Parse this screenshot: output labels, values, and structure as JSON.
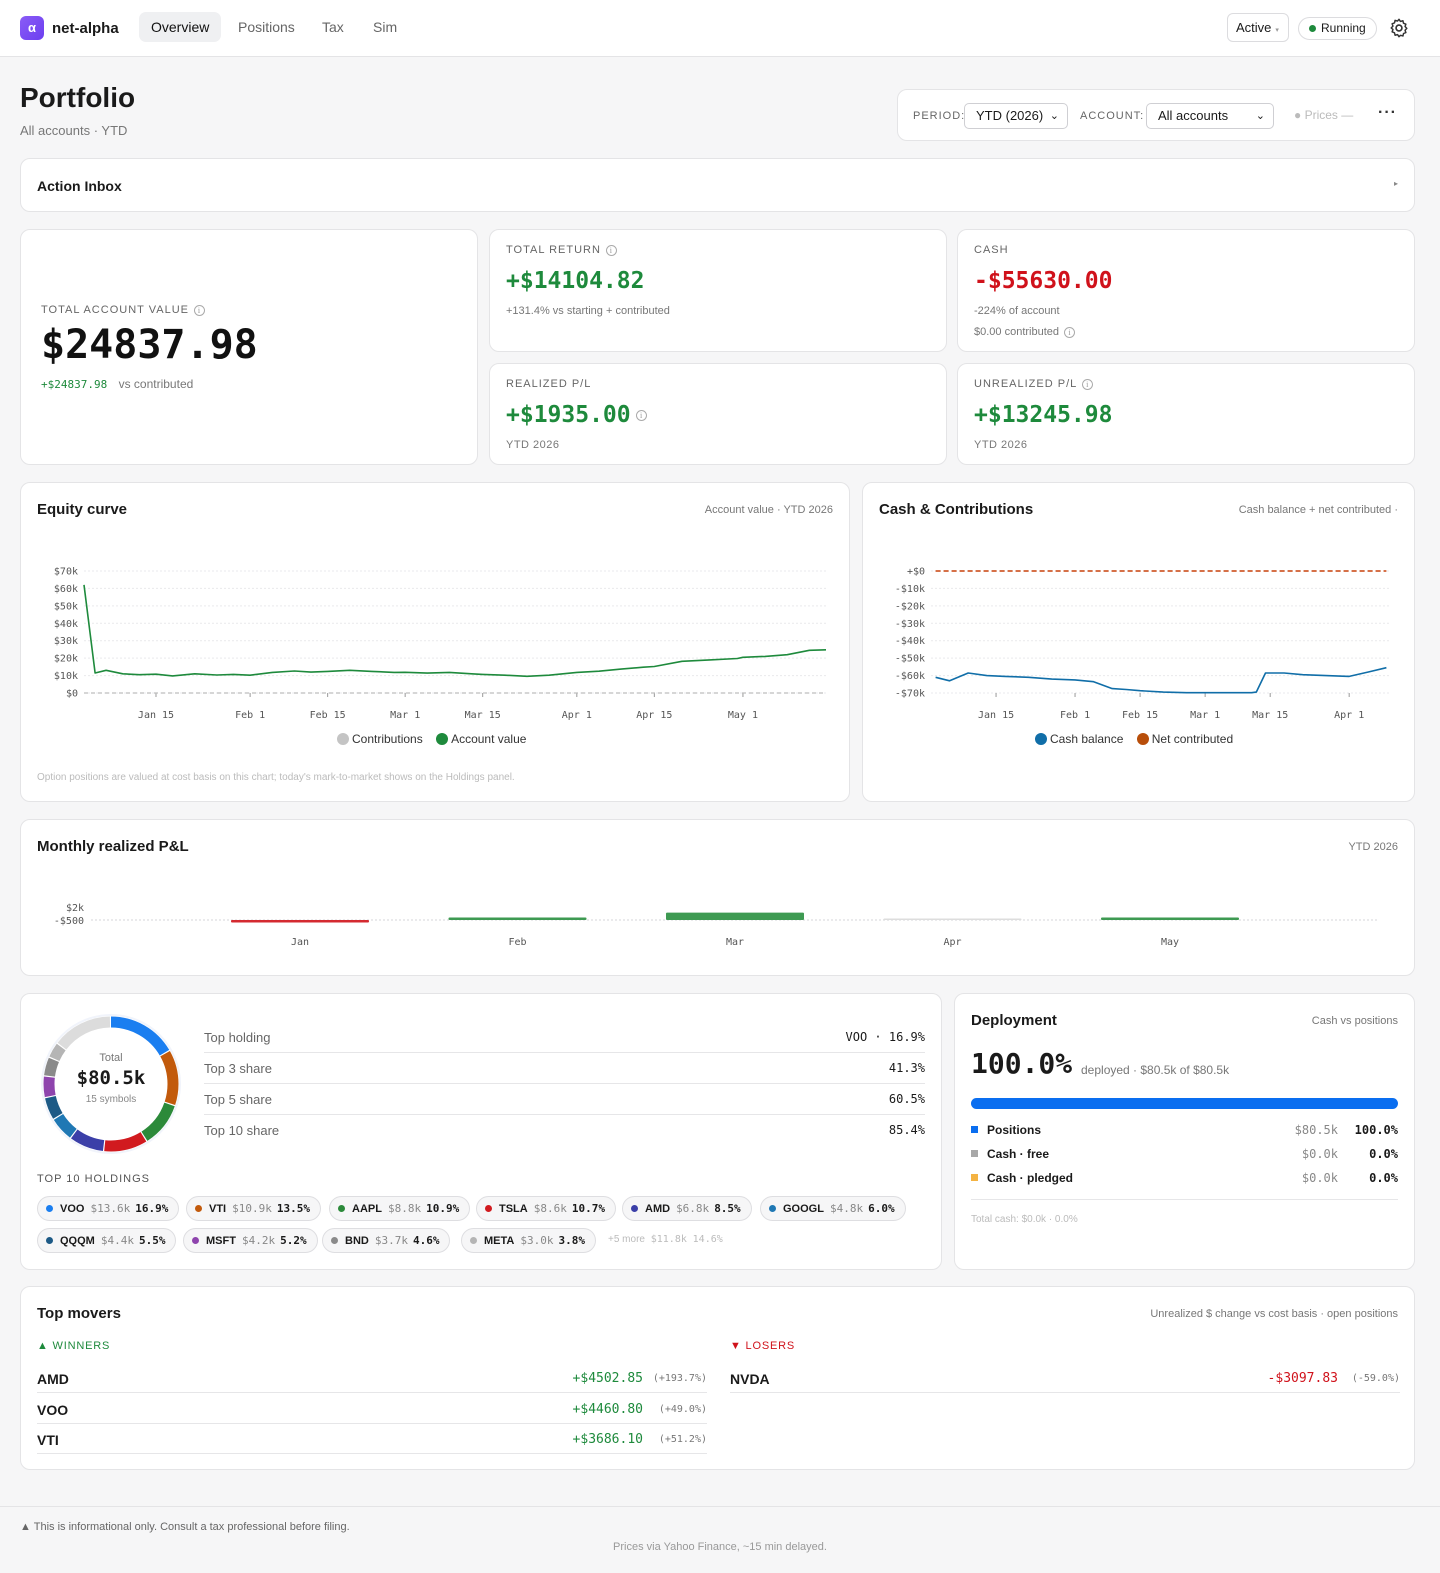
{
  "app": {
    "name": "net-alpha",
    "logo_glyph": "α"
  },
  "nav": {
    "tabs": [
      "Overview",
      "Positions",
      "Tax",
      "Sim"
    ],
    "active": "Overview"
  },
  "topbar": {
    "profile_select": "Active",
    "status": "Running"
  },
  "header": {
    "title": "Portfolio",
    "subtitle": "All accounts · YTD"
  },
  "filters": {
    "period_label": "PERIOD:",
    "period_value": "YTD (2026)",
    "account_label": "ACCOUNT:",
    "account_value": "All accounts",
    "prices": "Prices —",
    "more": "···"
  },
  "action_inbox": {
    "title": "Action Inbox",
    "caret": "▸"
  },
  "stats": {
    "total_account_value": {
      "label": "TOTAL ACCOUNT VALUE",
      "value": "$24837.98",
      "delta": "+$24837.98",
      "delta_note": "vs contributed"
    },
    "total_return": {
      "label": "TOTAL RETURN",
      "value": "+$14104.82",
      "note": "+131.4% vs starting + contributed"
    },
    "cash": {
      "label": "CASH",
      "value": "-$55630.00",
      "note1": "-224% of account",
      "note2": "$0.00 contributed"
    },
    "realized": {
      "label": "REALIZED P/L",
      "value": "+$1935.00",
      "note": "YTD 2026"
    },
    "unrealized": {
      "label": "UNREALIZED P/L",
      "value": "+$13245.98",
      "note": "YTD 2026"
    }
  },
  "equity_curve": {
    "title": "Equity curve",
    "meta": "Account value · YTD 2026",
    "footnote": "Option positions are valued at cost basis on this chart; today's mark-to-market shows on the Holdings panel.",
    "legend": [
      "Contributions",
      "Account value"
    ]
  },
  "cash_chart": {
    "title": "Cash & Contributions",
    "meta": "Cash balance + net contributed ·",
    "legend": [
      "Cash balance",
      "Net contributed"
    ]
  },
  "monthly_pl": {
    "title": "Monthly realized P&L",
    "meta": "YTD 2026"
  },
  "chart_data": [
    {
      "type": "line",
      "x_ticks": [
        "Jan 15",
        "Feb 1",
        "Feb 15",
        "Mar 1",
        "Mar 15",
        "Apr 1",
        "Apr 15",
        "May 1"
      ],
      "y_ticks": [
        "$0",
        "$10k",
        "$20k",
        "$30k",
        "$40k",
        "$50k",
        "$60k",
        "$70k"
      ],
      "ylim": [
        0,
        70000
      ],
      "x": [
        "Jan 2",
        "Jan 4",
        "Jan 6",
        "Jan 9",
        "Jan 12",
        "Jan 15",
        "Jan 18",
        "Jan 22",
        "Jan 26",
        "Jan 29",
        "Feb 1",
        "Feb 5",
        "Feb 9",
        "Feb 12",
        "Feb 15",
        "Feb 19",
        "Feb 23",
        "Feb 27",
        "Mar 1",
        "Mar 5",
        "Mar 9",
        "Mar 13",
        "Mar 15",
        "Mar 19",
        "Mar 23",
        "Mar 27",
        "Apr 1",
        "Apr 5",
        "Apr 9",
        "Apr 13",
        "Apr 15",
        "Apr 20",
        "Apr 25",
        "Apr 30",
        "May 1",
        "May 5",
        "May 9",
        "May 13",
        "May 16"
      ],
      "series": [
        {
          "name": "Account value",
          "values": [
            62000,
            11500,
            13000,
            11000,
            10500,
            10800,
            9800,
            11000,
            10300,
            10700,
            10200,
            11800,
            12600,
            12000,
            12400,
            13000,
            12400,
            11800,
            11900,
            11400,
            11800,
            11000,
            10700,
            10200,
            9600,
            10200,
            11800,
            12500,
            13700,
            14800,
            15200,
            18200,
            19000,
            19800,
            20500,
            21000,
            22000,
            24500,
            24800
          ]
        },
        {
          "name": "Contributions",
          "values": [
            0,
            0,
            0,
            0,
            0,
            0,
            0,
            0,
            0,
            0,
            0,
            0,
            0,
            0,
            0,
            0,
            0,
            0,
            0,
            0,
            0,
            0,
            0,
            0,
            0,
            0,
            0,
            0,
            0,
            0,
            0,
            0,
            0,
            0,
            0,
            0,
            0,
            0,
            0
          ]
        }
      ]
    },
    {
      "type": "line",
      "x_ticks": [
        "Jan 15",
        "Feb 1",
        "Feb 15",
        "Mar 1",
        "Mar 15",
        "Apr 1"
      ],
      "y_ticks": [
        "-$70k",
        "-$60k",
        "-$50k",
        "-$40k",
        "-$30k",
        "-$20k",
        "-$10k",
        "+$0"
      ],
      "ylim": [
        -70000,
        0
      ],
      "x": [
        "Jan 2",
        "Jan 5",
        "Jan 9",
        "Jan 13",
        "Jan 17",
        "Jan 22",
        "Jan 27",
        "Feb 1",
        "Feb 5",
        "Feb 9",
        "Feb 12",
        "Feb 15",
        "Feb 20",
        "Feb 25",
        "Mar 1",
        "Mar 6",
        "Mar 11",
        "Mar 12",
        "Mar 14",
        "Mar 18",
        "Mar 22",
        "Mar 27",
        "Apr 1",
        "Apr 5",
        "Apr 9"
      ],
      "series": [
        {
          "name": "Cash balance",
          "values": [
            -61000,
            -63000,
            -58500,
            -60000,
            -60500,
            -61000,
            -62000,
            -62500,
            -63500,
            -67500,
            -68000,
            -68700,
            -69500,
            -69800,
            -69800,
            -69800,
            -69800,
            -69500,
            -58500,
            -58500,
            -59500,
            -60000,
            -60500,
            -58000,
            -55500
          ]
        },
        {
          "name": "Net contributed",
          "values": [
            0,
            0,
            0,
            0,
            0,
            0,
            0,
            0,
            0,
            0,
            0,
            0,
            0,
            0,
            0,
            0,
            0,
            0,
            0,
            0,
            0,
            0,
            0,
            0,
            0
          ]
        }
      ]
    },
    {
      "type": "bar",
      "categories": [
        "Jan",
        "Feb",
        "Mar",
        "Apr",
        "May"
      ],
      "values": [
        -500,
        100,
        2100,
        0,
        100
      ],
      "y_ticks": [
        "-$500",
        "$2k"
      ],
      "ylim": [
        -500,
        2000
      ]
    }
  ],
  "concentration": {
    "total_label": "Total",
    "total_value": "$80.5k",
    "symbols_note": "15 symbols",
    "rows": [
      {
        "label": "Top holding",
        "value": "VOO · 16.9%"
      },
      {
        "label": "Top 3 share",
        "value": "41.3%"
      },
      {
        "label": "Top 5 share",
        "value": "60.5%"
      },
      {
        "label": "Top 10 share",
        "value": "85.4%"
      }
    ],
    "top10_label": "TOP 10 HOLDINGS",
    "holdings": [
      {
        "sym": "VOO",
        "amt": "$13.6k",
        "pct": "16.9%",
        "share": 16.9,
        "color": "#1a7ef0"
      },
      {
        "sym": "VTI",
        "amt": "$10.9k",
        "pct": "13.5%",
        "share": 13.5,
        "color": "#c25a0c"
      },
      {
        "sym": "AAPL",
        "amt": "$8.8k",
        "pct": "10.9%",
        "share": 10.9,
        "color": "#2c8a3a"
      },
      {
        "sym": "TSLA",
        "amt": "$8.6k",
        "pct": "10.7%",
        "share": 10.7,
        "color": "#d11a1f"
      },
      {
        "sym": "AMD",
        "amt": "$6.8k",
        "pct": "8.5%",
        "share": 8.5,
        "color": "#3b3fa8"
      },
      {
        "sym": "GOOGL",
        "amt": "$4.8k",
        "pct": "6.0%",
        "share": 6.0,
        "color": "#1f78b4"
      },
      {
        "sym": "QQQM",
        "amt": "$4.4k",
        "pct": "5.5%",
        "share": 5.5,
        "color": "#1d5a86"
      },
      {
        "sym": "MSFT",
        "amt": "$4.2k",
        "pct": "5.2%",
        "share": 5.2,
        "color": "#8e44ad"
      },
      {
        "sym": "BND",
        "amt": "$3.7k",
        "pct": "4.6%",
        "share": 4.6,
        "color": "#8a8a8a"
      },
      {
        "sym": "META",
        "amt": "$3.0k",
        "pct": "3.8%",
        "share": 3.8,
        "color": "#b5b5b5"
      }
    ],
    "more": {
      "label": "+5 more",
      "amt": "$11.8k",
      "pct": "14.6%",
      "share": 14.6,
      "color": "#dcdcdc"
    }
  },
  "deployment": {
    "title": "Deployment",
    "meta": "Cash vs positions",
    "pct": "100.0%",
    "note": "deployed · $80.5k of $80.5k",
    "fill": 1.0,
    "rows": [
      {
        "label": "Positions",
        "amt": "$80.5k",
        "pct": "100.0%",
        "color": "#0a6ef0"
      },
      {
        "label": "Cash · free",
        "amt": "$0.0k",
        "pct": "0.0%",
        "color": "#a8a8a8"
      },
      {
        "label": "Cash · pledged",
        "amt": "$0.0k",
        "pct": "0.0%",
        "color": "#f4b342"
      }
    ],
    "total_cash": "Total cash: $0.0k · 0.0%"
  },
  "movers": {
    "title": "Top movers",
    "meta": "Unrealized $ change vs cost basis · open positions",
    "winners_label": "▲ WINNERS",
    "losers_label": "▼ LOSERS",
    "winners": [
      {
        "sym": "AMD",
        "val": "+$4502.85",
        "pct": "(+193.7%)"
      },
      {
        "sym": "VOO",
        "val": "+$4460.80",
        "pct": "(+49.0%)"
      },
      {
        "sym": "VTI",
        "val": "+$3686.10",
        "pct": "(+51.2%)"
      }
    ],
    "losers": [
      {
        "sym": "NVDA",
        "val": "-$3097.83",
        "pct": "(-59.0%)"
      }
    ]
  },
  "footer": {
    "disclaimer": "This is informational only. Consult a tax professional before filing.",
    "prices_note": "Prices via Yahoo Finance, ~15 min delayed."
  }
}
